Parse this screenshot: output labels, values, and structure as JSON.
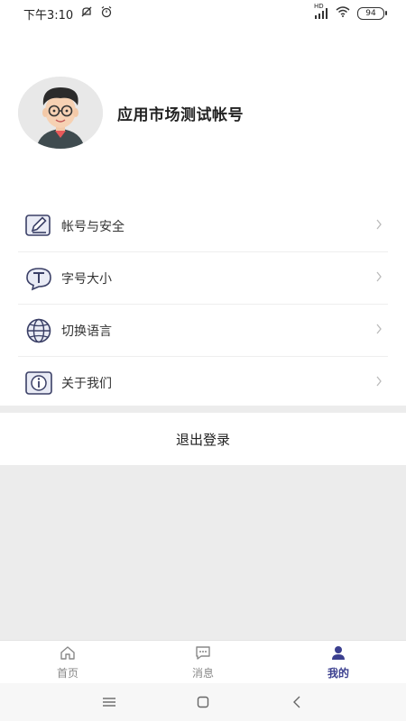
{
  "status_bar": {
    "time": "下午3:10",
    "network_label": "HD",
    "battery": "94"
  },
  "profile": {
    "name": "应用市场测试帐号"
  },
  "menu": {
    "items": [
      {
        "label": "帐号与安全",
        "icon": "edit-icon"
      },
      {
        "label": "字号大小",
        "icon": "font-size-icon"
      },
      {
        "label": "切换语言",
        "icon": "globe-icon"
      },
      {
        "label": "关于我们",
        "icon": "info-icon"
      }
    ]
  },
  "logout": {
    "label": "退出登录"
  },
  "tabbar": {
    "tabs": [
      {
        "label": "首页",
        "icon": "home-icon",
        "active": false
      },
      {
        "label": "消息",
        "icon": "message-icon",
        "active": false
      },
      {
        "label": "我的",
        "icon": "user-icon",
        "active": true
      }
    ]
  },
  "colors": {
    "accent": "#3b3f8f",
    "icon_stroke": "#3a3f66",
    "background_gray": "#ececec"
  }
}
